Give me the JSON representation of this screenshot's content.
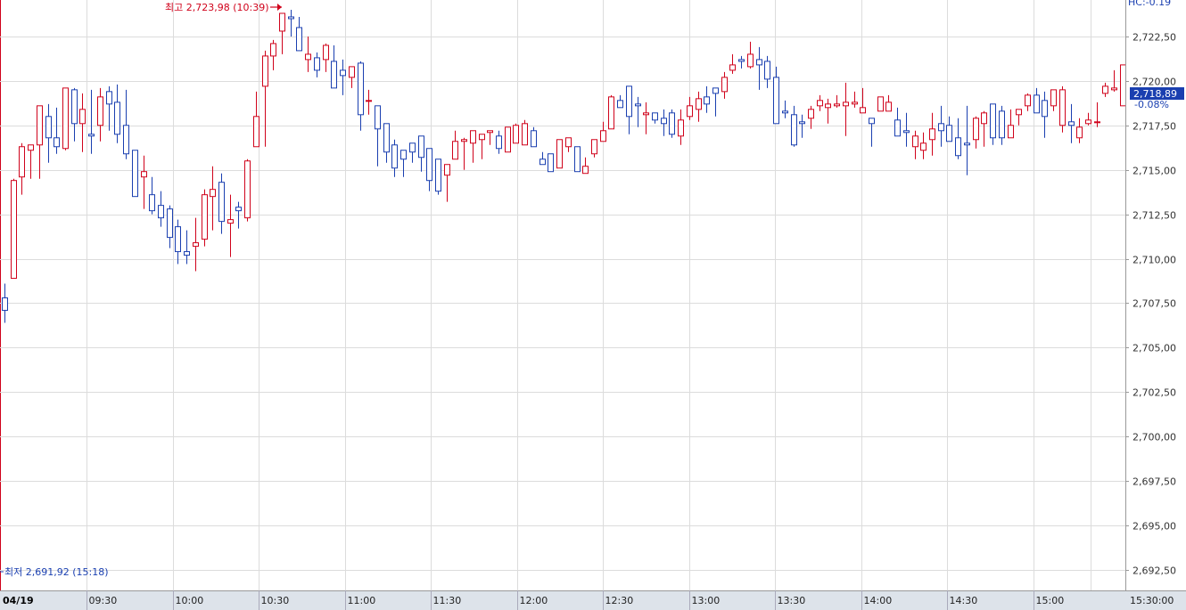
{
  "chart_data": {
    "type": "candlestick",
    "date_label": "04/19",
    "x_tick_labels": [
      "09:30",
      "10:00",
      "10:30",
      "11:00",
      "11:30",
      "12:00",
      "12:30",
      "13:00",
      "13:30",
      "14:00",
      "14:30",
      "15:00"
    ],
    "x_end_label": "15:30:00",
    "y_tick_labels": [
      "2,722,50",
      "2,720,00",
      "2,717,50",
      "2,715,00",
      "2,712,50",
      "2,710,00",
      "2,707,50",
      "2,705,00",
      "2,702,50",
      "2,700,00",
      "2,697,50",
      "2,695,00",
      "2,692,50"
    ],
    "y_tick_values": [
      2722.5,
      2720.0,
      2717.5,
      2715.0,
      2712.5,
      2710.0,
      2707.5,
      2705.0,
      2702.5,
      2700.0,
      2697.5,
      2695.0,
      2692.5
    ],
    "ylim": [
      2691.35,
      2724.55
    ],
    "high_annotation": "최고 2,723,98 (10:39)",
    "low_annotation": "최저 2,691,92 (15:18)",
    "current_value_label": "2,718,89",
    "change_label": "-0.08%",
    "corner_label": "HC:-0.19",
    "colors": {
      "up": "#d0021b",
      "down": "#1a3fb0",
      "grid": "#dcdcdc",
      "axis_bg": "#dde3ea"
    },
    "candles": [
      [
        2707.8,
        2708.6,
        2706.4,
        2707.1
      ],
      [
        2708.9,
        2714.5,
        2708.9,
        2714.4
      ],
      [
        2714.6,
        2716.5,
        2713.6,
        2716.3
      ],
      [
        2716.1,
        2716.3,
        2714.5,
        2716.4
      ],
      [
        2716.4,
        2718.6,
        2714.5,
        2718.6
      ],
      [
        2718.0,
        2718.7,
        2715.4,
        2716.8
      ],
      [
        2716.8,
        2718.5,
        2715.9,
        2716.3
      ],
      [
        2716.2,
        2719.6,
        2716.1,
        2719.6
      ],
      [
        2719.5,
        2719.6,
        2716.6,
        2717.6
      ],
      [
        2717.6,
        2719.3,
        2716.0,
        2718.4
      ],
      [
        2717.0,
        2719.5,
        2715.9,
        2716.9
      ],
      [
        2717.5,
        2719.6,
        2716.6,
        2719.1
      ],
      [
        2719.4,
        2719.7,
        2717.2,
        2718.7
      ],
      [
        2718.8,
        2719.8,
        2716.5,
        2717.0
      ],
      [
        2717.5,
        2719.5,
        2715.6,
        2715.9
      ],
      [
        2716.1,
        2716.1,
        2713.8,
        2713.5
      ],
      [
        2714.6,
        2715.8,
        2712.8,
        2714.9
      ],
      [
        2713.6,
        2714.6,
        2712.5,
        2712.7
      ],
      [
        2713.0,
        2713.8,
        2711.8,
        2712.3
      ],
      [
        2712.8,
        2713.0,
        2710.6,
        2711.2
      ],
      [
        2711.8,
        2712.2,
        2709.7,
        2710.4
      ],
      [
        2710.4,
        2711.6,
        2709.7,
        2710.2
      ],
      [
        2710.7,
        2712.3,
        2709.3,
        2710.9
      ],
      [
        2711.1,
        2713.9,
        2710.7,
        2713.6
      ],
      [
        2713.5,
        2715.2,
        2711.6,
        2713.9
      ],
      [
        2714.3,
        2714.8,
        2711.4,
        2712.1
      ],
      [
        2712.0,
        2713.6,
        2710.1,
        2712.2
      ],
      [
        2712.9,
        2713.2,
        2711.7,
        2712.7
      ],
      [
        2712.3,
        2715.6,
        2712.1,
        2715.5
      ],
      [
        2716.3,
        2719.4,
        2716.3,
        2718.0
      ],
      [
        2719.7,
        2721.7,
        2716.3,
        2721.4
      ],
      [
        2721.4,
        2722.3,
        2720.6,
        2722.1
      ],
      [
        2722.8,
        2723.5,
        2721.5,
        2723.8
      ],
      [
        2723.6,
        2724.0,
        2722.5,
        2723.5
      ],
      [
        2723.0,
        2723.6,
        2722.4,
        2721.7
      ],
      [
        2721.2,
        2722.5,
        2720.5,
        2721.5
      ],
      [
        2721.3,
        2721.6,
        2720.2,
        2720.6
      ],
      [
        2721.2,
        2722.1,
        2720.5,
        2722.0
      ],
      [
        2721.1,
        2722.0,
        2719.7,
        2719.6
      ],
      [
        2720.6,
        2721.2,
        2719.2,
        2720.3
      ],
      [
        2720.2,
        2720.8,
        2719.6,
        2720.8
      ],
      [
        2721.0,
        2721.1,
        2717.2,
        2718.1
      ],
      [
        2718.9,
        2719.5,
        2718.1,
        2718.9
      ],
      [
        2718.6,
        2718.4,
        2715.2,
        2717.3
      ],
      [
        2717.6,
        2717.5,
        2715.4,
        2716.0
      ],
      [
        2716.4,
        2716.7,
        2714.6,
        2715.1
      ],
      [
        2716.1,
        2716.1,
        2714.6,
        2715.6
      ],
      [
        2716.5,
        2716.1,
        2715.4,
        2716.0
      ],
      [
        2716.9,
        2716.5,
        2714.9,
        2715.7
      ],
      [
        2716.2,
        2716.2,
        2713.8,
        2714.4
      ],
      [
        2715.6,
        2715.6,
        2713.6,
        2713.8
      ],
      [
        2714.7,
        2715.3,
        2713.2,
        2715.3
      ],
      [
        2715.6,
        2717.2,
        2715.6,
        2716.6
      ],
      [
        2716.6,
        2716.8,
        2715.0,
        2716.7
      ],
      [
        2716.5,
        2717.0,
        2715.4,
        2717.2
      ],
      [
        2716.7,
        2716.9,
        2715.6,
        2717.0
      ],
      [
        2717.1,
        2717.2,
        2716.4,
        2717.2
      ],
      [
        2716.9,
        2717.2,
        2715.9,
        2716.2
      ],
      [
        2716.0,
        2717.3,
        2716.6,
        2717.4
      ],
      [
        2716.5,
        2717.6,
        2716.6,
        2717.5
      ],
      [
        2716.4,
        2717.8,
        2716.5,
        2717.6
      ],
      [
        2717.2,
        2717.4,
        2716.6,
        2716.3
      ],
      [
        2715.6,
        2716.0,
        2715.3,
        2715.3
      ],
      [
        2715.9,
        2715.7,
        2714.9,
        2714.9
      ],
      [
        2715.1,
        2716.7,
        2715.1,
        2716.7
      ],
      [
        2716.3,
        2716.7,
        2716.0,
        2716.8
      ],
      [
        2716.3,
        2716.3,
        2715.9,
        2714.9
      ],
      [
        2714.8,
        2715.7,
        2714.9,
        2715.2
      ],
      [
        2715.9,
        2716.4,
        2715.7,
        2716.7
      ],
      [
        2716.6,
        2717.7,
        2716.6,
        2717.2
      ],
      [
        2717.3,
        2719.2,
        2717.3,
        2719.1
      ],
      [
        2718.9,
        2719.2,
        2718.6,
        2718.5
      ],
      [
        2719.7,
        2719.2,
        2717.0,
        2718.0
      ],
      [
        2718.7,
        2719.1,
        2717.4,
        2718.6
      ],
      [
        2718.1,
        2718.8,
        2717.0,
        2718.2
      ],
      [
        2718.2,
        2717.9,
        2717.6,
        2717.8
      ],
      [
        2717.9,
        2718.4,
        2716.9,
        2717.6
      ],
      [
        2718.2,
        2718.4,
        2716.8,
        2717.0
      ],
      [
        2716.9,
        2718.4,
        2716.4,
        2717.8
      ],
      [
        2718.0,
        2719.1,
        2717.8,
        2718.6
      ],
      [
        2718.4,
        2719.4,
        2717.7,
        2719.0
      ],
      [
        2719.1,
        2719.7,
        2718.2,
        2718.7
      ],
      [
        2719.6,
        2718.8,
        2718.0,
        2719.3
      ],
      [
        2719.4,
        2720.5,
        2719.0,
        2720.2
      ],
      [
        2720.6,
        2721.5,
        2720.4,
        2720.9
      ],
      [
        2721.2,
        2721.4,
        2720.7,
        2721.1
      ],
      [
        2720.8,
        2722.2,
        2720.7,
        2721.5
      ],
      [
        2721.2,
        2721.9,
        2719.5,
        2720.9
      ],
      [
        2721.1,
        2721.4,
        2719.6,
        2720.1
      ],
      [
        2720.2,
        2720.8,
        2719.3,
        2717.6
      ],
      [
        2718.3,
        2718.9,
        2717.9,
        2718.2
      ],
      [
        2718.1,
        2718.6,
        2716.3,
        2716.4
      ],
      [
        2717.7,
        2718.1,
        2716.8,
        2717.6
      ],
      [
        2717.9,
        2718.6,
        2717.3,
        2718.4
      ],
      [
        2718.6,
        2719.2,
        2718.3,
        2718.9
      ],
      [
        2718.5,
        2719.0,
        2717.6,
        2718.7
      ],
      [
        2718.6,
        2719.2,
        2718.5,
        2718.7
      ],
      [
        2718.6,
        2719.9,
        2716.9,
        2718.8
      ],
      [
        2718.7,
        2719.4,
        2718.5,
        2718.8
      ],
      [
        2718.2,
        2719.6,
        2718.2,
        2718.5
      ],
      [
        2717.9,
        2717.8,
        2716.3,
        2717.6
      ],
      [
        2718.3,
        2719.1,
        2718.4,
        2719.1
      ],
      [
        2718.3,
        2719.2,
        2718.6,
        2718.8
      ],
      [
        2717.8,
        2718.5,
        2717.5,
        2716.9
      ],
      [
        2717.2,
        2718.2,
        2716.3,
        2717.1
      ],
      [
        2716.3,
        2717.2,
        2715.6,
        2716.9
      ],
      [
        2716.1,
        2717.1,
        2715.6,
        2716.5
      ],
      [
        2716.7,
        2718.2,
        2715.8,
        2717.3
      ],
      [
        2717.6,
        2718.6,
        2716.3,
        2717.2
      ],
      [
        2717.5,
        2718.0,
        2716.7,
        2716.6
      ],
      [
        2716.8,
        2717.9,
        2715.6,
        2715.8
      ],
      [
        2716.5,
        2718.6,
        2714.7,
        2716.4
      ],
      [
        2716.7,
        2718.0,
        2716.2,
        2717.9
      ],
      [
        2717.6,
        2718.3,
        2716.3,
        2718.2
      ],
      [
        2718.7,
        2718.7,
        2716.4,
        2716.8
      ],
      [
        2718.3,
        2718.6,
        2716.4,
        2716.8
      ],
      [
        2716.8,
        2718.4,
        2716.8,
        2717.5
      ],
      [
        2718.1,
        2718.3,
        2717.5,
        2718.4
      ],
      [
        2718.6,
        2719.3,
        2718.3,
        2719.2
      ],
      [
        2719.2,
        2719.6,
        2718.3,
        2718.2
      ],
      [
        2718.9,
        2719.4,
        2716.8,
        2718.0
      ],
      [
        2718.6,
        2719.5,
        2718.3,
        2719.5
      ],
      [
        2717.5,
        2719.7,
        2717.1,
        2719.5
      ],
      [
        2717.7,
        2718.7,
        2716.5,
        2717.5
      ],
      [
        2716.8,
        2717.9,
        2716.5,
        2717.4
      ],
      [
        2717.6,
        2718.2,
        2717.5,
        2717.8
      ],
      [
        2717.7,
        2718.8,
        2717.4,
        2717.7
      ],
      [
        2719.3,
        2719.9,
        2719.1,
        2719.7
      ],
      [
        2719.5,
        2720.6,
        2719.4,
        2719.6
      ],
      [
        2718.6,
        2720.7,
        2719.3,
        2720.9
      ],
      [
        2719.0,
        2721.1,
        2718.7,
        2720.9
      ]
    ]
  }
}
